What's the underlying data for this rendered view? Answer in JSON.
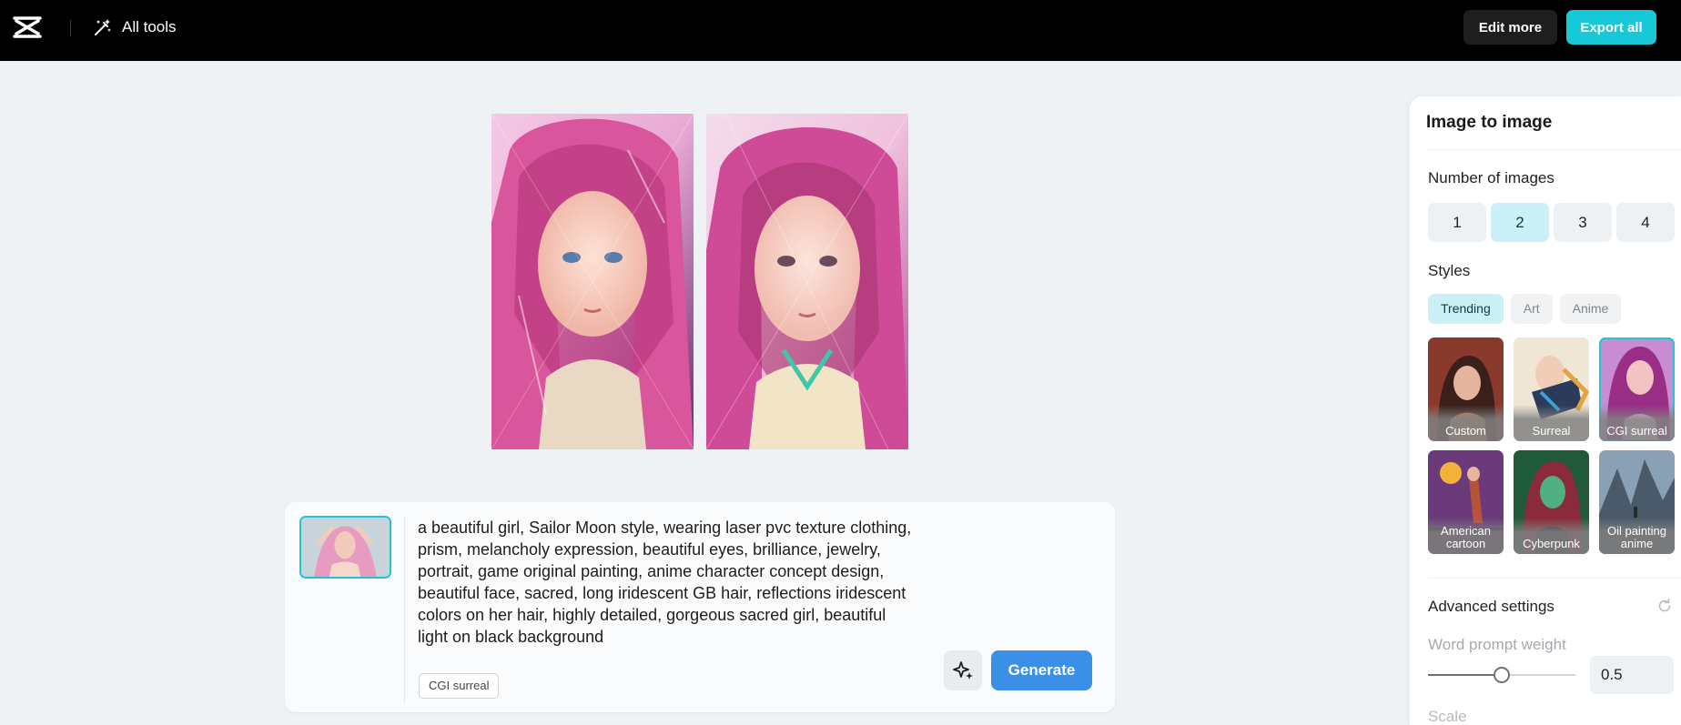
{
  "topbar": {
    "logo_icon": "capcut-logo-icon",
    "all_tools_icon": "magic-wand-icon",
    "all_tools_label": "All tools",
    "edit_more_label": "Edit more",
    "export_all_label": "Export all"
  },
  "results": {
    "count": 2
  },
  "prompt": {
    "text": "a beautiful girl, Sailor Moon style, wearing laser pvc texture clothing, prism, melancholy expression, beautiful eyes, brilliance, jewelry, portrait, game original painting, anime character concept design, beautiful face, sacred, long iridescent GB hair, reflections iridescent colors on her hair, highly detailed, gorgeous sacred girl, beautiful light on black background",
    "style_tag": "CGI surreal",
    "magic_icon": "sparkle-icon",
    "generate_label": "Generate"
  },
  "panel": {
    "title": "Image to image",
    "number_label": "Number of images",
    "numbers": [
      "1",
      "2",
      "3",
      "4"
    ],
    "selected_number": "2",
    "styles_label": "Styles",
    "tabs": [
      "Trending",
      "Art",
      "Anime"
    ],
    "active_tab": "Trending",
    "styles": [
      {
        "label": "Custom",
        "selected": false
      },
      {
        "label": "Surreal",
        "selected": false
      },
      {
        "label": "CGI surreal",
        "selected": true
      },
      {
        "label": "American cartoon",
        "selected": false
      },
      {
        "label": "Cyberpunk",
        "selected": false
      },
      {
        "label": "Oil painting anime",
        "selected": false
      }
    ],
    "advanced_label": "Advanced settings",
    "reset_icon": "reset-icon",
    "word_weight_label": "Word prompt weight",
    "word_weight_value": "0.5",
    "word_weight_fraction": 0.5,
    "next_label_partial": "Scale"
  },
  "colors": {
    "accent": "#17c8d8",
    "generate": "#3b8fe6",
    "selection": "#cbf1f6"
  }
}
